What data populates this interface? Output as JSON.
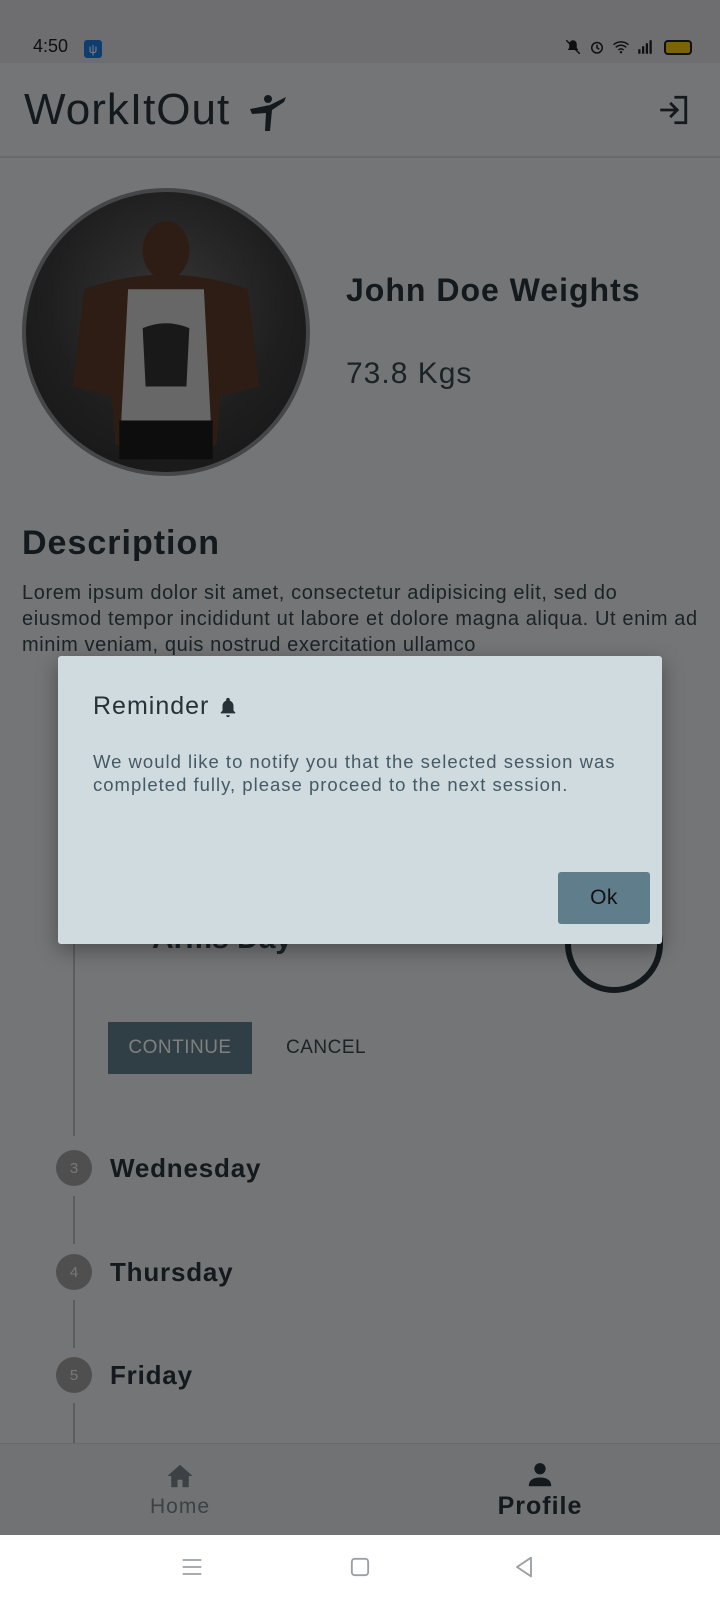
{
  "status_bar": {
    "time": "4:50"
  },
  "app_bar": {
    "title": "WorkItOut"
  },
  "profile": {
    "name": "John Doe Weights",
    "weight": "73.8 Kgs"
  },
  "description": {
    "title": "Description",
    "text": "Lorem ipsum dolor sit amet, consectetur adipisicing elit, sed do eiusmod tempor incididunt ut labore et dolore magna aliqua. Ut enim ad minim veniam, quis nostrud exercitation ullamco"
  },
  "stepper": {
    "current_step_title": "Arms Day",
    "current_progress": "100%",
    "continue_label": "CONTINUE",
    "cancel_label": "CANCEL",
    "steps": [
      {
        "number": "3",
        "label": "Wednesday"
      },
      {
        "number": "4",
        "label": "Thursday"
      },
      {
        "number": "5",
        "label": "Friday"
      }
    ]
  },
  "bottom_nav": {
    "home_label": "Home",
    "profile_label": "Profile",
    "active": "Profile"
  },
  "dialog": {
    "title": "Reminder",
    "body": "We would like to notify you that the selected session was completed fully, please proceed to the next session.",
    "ok_label": "Ok"
  },
  "colors": {
    "primary": "#607d8b",
    "dark_text": "#263238",
    "dialog_bg": "#d0dbe0"
  }
}
